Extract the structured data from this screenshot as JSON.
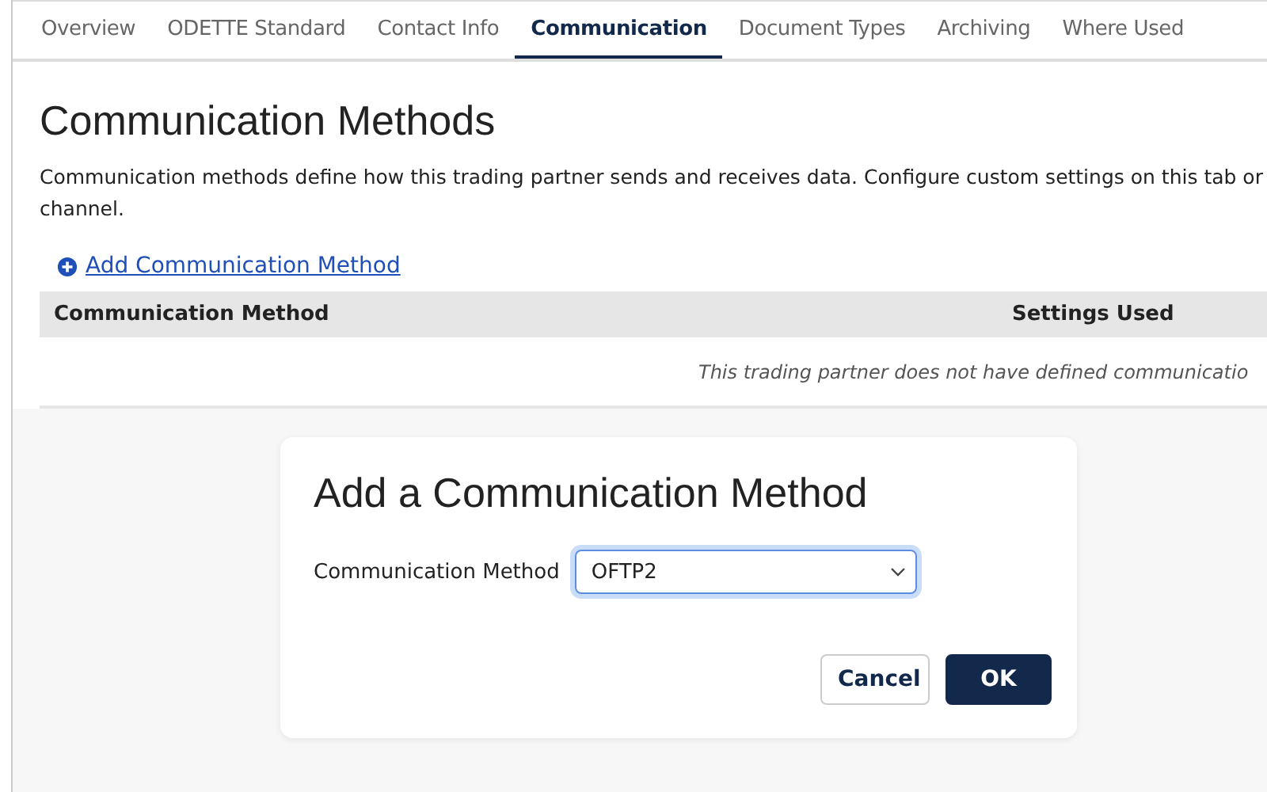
{
  "tabs": [
    {
      "label": "Overview",
      "selected": false
    },
    {
      "label": "ODETTE Standard",
      "selected": false
    },
    {
      "label": "Contact Info",
      "selected": false
    },
    {
      "label": "Communication",
      "selected": true
    },
    {
      "label": "Document Types",
      "selected": false
    },
    {
      "label": "Archiving",
      "selected": false
    },
    {
      "label": "Where Used",
      "selected": false
    }
  ],
  "title": "Communication Methods",
  "description_lines": [
    "Communication methods define how this trading partner sends and receives data. Configure custom settings on this tab or",
    "channel."
  ],
  "add_link": "Add Communication Method",
  "table": {
    "columns": [
      "Communication Method",
      "Settings Used"
    ],
    "empty_message": "This trading partner does not have defined communicatio"
  },
  "dialog": {
    "title": "Add a Communication Method",
    "field_label": "Communication Method",
    "field_value": "OFTP2",
    "buttons": [
      {
        "label": "Cancel",
        "kind": "secondary"
      },
      {
        "label": "OK",
        "kind": "primary"
      }
    ]
  }
}
